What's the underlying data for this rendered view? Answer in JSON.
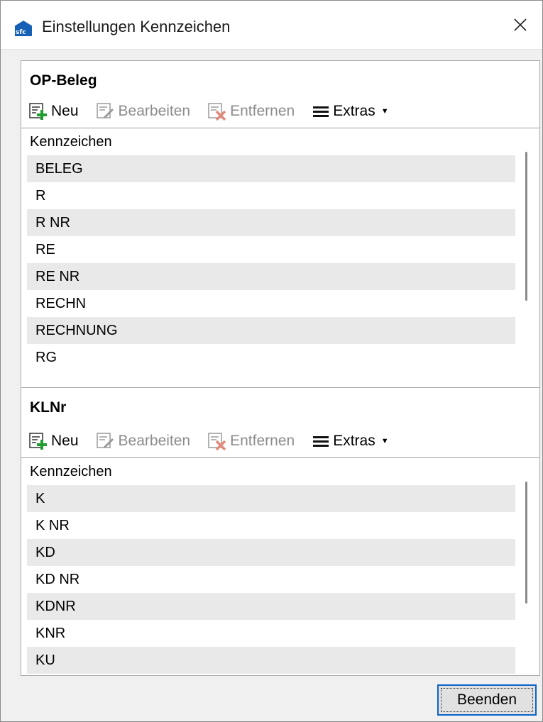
{
  "window": {
    "title": "Einstellungen Kennzeichen",
    "close_label": "×"
  },
  "sections": [
    {
      "title": "OP-Beleg",
      "toolbar": {
        "new_label": "Neu",
        "edit_label": "Bearbeiten",
        "remove_label": "Entfernen",
        "extras_label": "Extras"
      },
      "column_header": "Kennzeichen",
      "rows": [
        "BELEG",
        "R",
        "R NR",
        "RE",
        "RE NR",
        "RECHN",
        "RECHNUNG",
        "RG"
      ]
    },
    {
      "title": "KLNr",
      "toolbar": {
        "new_label": "Neu",
        "edit_label": "Bearbeiten",
        "remove_label": "Entfernen",
        "extras_label": "Extras"
      },
      "column_header": "Kennzeichen",
      "rows": [
        "K",
        "K NR",
        "KD",
        "KD NR",
        "KDNR",
        "KNR",
        "KU"
      ]
    }
  ],
  "footer": {
    "close_button_label": "Beenden"
  },
  "colors": {
    "accent": "#0a64c8",
    "row_alt": "#e9e9e9",
    "icon_green": "#1e9e2e",
    "icon_red": "#d0402a"
  }
}
